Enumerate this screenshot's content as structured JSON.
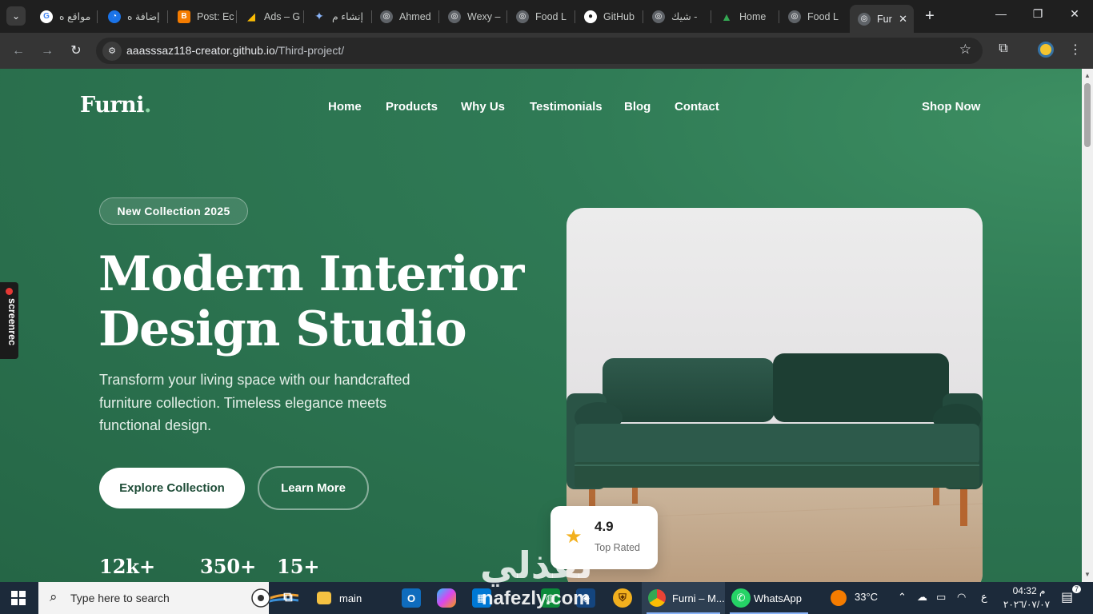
{
  "browser": {
    "tabs": [
      {
        "title": "مواقع ه",
        "icon": "google-icon",
        "color": "#4285f4"
      },
      {
        "title": "إضافة ه",
        "icon": "edge-blue-icon",
        "color": "#1a73e8"
      },
      {
        "title": "Post: Ec",
        "icon": "blogger-icon",
        "color": "#f57c00"
      },
      {
        "title": "Ads – G",
        "icon": "google-ads-icon",
        "color": "#fbbc04"
      },
      {
        "title": "إنشاء م",
        "icon": "gemini-icon",
        "color": "#7b61ff"
      },
      {
        "title": "Ahmed",
        "icon": "globe-icon",
        "color": "#9aa0a6"
      },
      {
        "title": "Wexy –",
        "icon": "globe-icon",
        "color": "#9aa0a6"
      },
      {
        "title": "Food L",
        "icon": "globe-icon",
        "color": "#9aa0a6"
      },
      {
        "title": "GitHub",
        "icon": "github-icon",
        "color": "#ffffff"
      },
      {
        "title": "شيك -",
        "icon": "globe-icon",
        "color": "#9aa0a6"
      },
      {
        "title": "Home",
        "icon": "google-drive-icon",
        "color": "#34a853"
      },
      {
        "title": "Food L",
        "icon": "globe-icon",
        "color": "#9aa0a6"
      },
      {
        "title": "Fur",
        "icon": "globe-icon",
        "color": "#9aa0a6"
      }
    ],
    "url_host": "aaasssaz118-creator.github.io",
    "url_path": "/Third-project/"
  },
  "site": {
    "logo": "Furni",
    "logo_dot": ".",
    "nav": [
      "Home",
      "Products",
      "Why Us",
      "Testimonials",
      "Blog",
      "Contact"
    ],
    "cta": "Shop Now",
    "badge": "New Collection 2025",
    "headline_line1": "Modern Interior",
    "headline_line2": "Design Studio",
    "subtitle": "Transform your living space with our handcrafted furniture collection. Timeless elegance meets functional design.",
    "primary_button": "Explore Collection",
    "secondary_button": "Learn More",
    "stats": [
      "12k+",
      "350+",
      "15+"
    ],
    "rating_value": "4.9",
    "rating_label": "Top Rated",
    "accent_color": "#2f7a55"
  },
  "overlay": {
    "screenrec_label": "screenrec",
    "watermark_arabic": "نفذلي",
    "watermark_latin": "nafezly.com"
  },
  "taskbar": {
    "search_placeholder": "Type here to search",
    "apps": [
      {
        "label": "main",
        "icon": "folder-icon"
      },
      {
        "label": "Furni – M...",
        "icon": "chrome-icon"
      },
      {
        "label": "WhatsApp",
        "icon": "whatsapp-icon"
      }
    ],
    "weather": "33°C",
    "lang": "ع",
    "time": "04:32 م",
    "date": "٢٠٢٦/٠٧/٠٧",
    "notification_count": "7"
  }
}
